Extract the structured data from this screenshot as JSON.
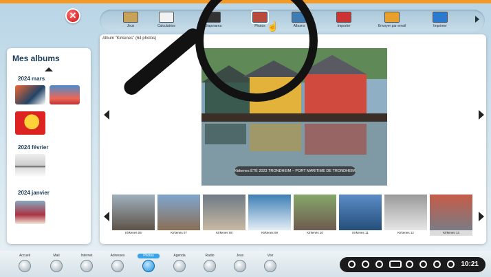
{
  "toolbar": {
    "items": [
      {
        "label": "Jeux",
        "icon": "game-icon",
        "color": "#c9a25a"
      },
      {
        "label": "Calculatrice",
        "icon": "calculator-icon",
        "color": "#f2f2f2"
      },
      {
        "label": "Diaporama",
        "icon": "slideshow-icon",
        "color": "#333333"
      },
      {
        "label": "Photos",
        "icon": "photos-icon",
        "color": "#b94a3c"
      },
      {
        "label": "Albums",
        "icon": "albums-icon",
        "color": "#3d7db3"
      },
      {
        "label": "Importer",
        "icon": "import-icon",
        "color": "#c33"
      },
      {
        "label": "Envoyer par email",
        "icon": "email-icon",
        "color": "#e8a02a"
      },
      {
        "label": "Imprimer",
        "icon": "printer-icon",
        "color": "#2a7bd0"
      }
    ]
  },
  "sidebar": {
    "title": "Mes albums",
    "months": [
      "2024 mars",
      "2024 février",
      "2024 janvier"
    ]
  },
  "main": {
    "album_caption": "Album \"Kirkenes\" (64 photos)",
    "photo_caption": "Kirkenes ÉTÉ 2023 TRONDHEIM – PORT MARITIME DE TRONDHEIM"
  },
  "thumbnails": [
    {
      "label": "Kirkenes 06",
      "color_top": "#9fb0bd",
      "color_bottom": "#5d5348"
    },
    {
      "label": "Kirkenes 07",
      "color_top": "#7fa6cf",
      "color_bottom": "#8a6f55"
    },
    {
      "label": "Kirkenes 08",
      "color_top": "#6f7b85",
      "color_bottom": "#c8b9a4"
    },
    {
      "label": "Kirkenes 09",
      "color_top": "#3e7fb5",
      "color_bottom": "#e3eef5"
    },
    {
      "label": "Kirkenes 10",
      "color_top": "#86a76a",
      "color_bottom": "#6d5b4f"
    },
    {
      "label": "Kirkenes 11",
      "color_top": "#5c8cc8",
      "color_bottom": "#234f79"
    },
    {
      "label": "Kirkenes 12",
      "color_top": "#9a9a9a",
      "color_bottom": "#e6e6e6"
    },
    {
      "label": "Kirkenes 13",
      "color_top": "#c75b47",
      "color_bottom": "#7a7c84"
    }
  ],
  "dock": {
    "items": [
      "Accueil",
      "Mail",
      "Internet",
      "Adresses",
      "Photos",
      "Agenda",
      "Radio",
      "Jeux",
      "Voir"
    ],
    "active": "Photos"
  },
  "system": {
    "time": "10:21"
  },
  "colors": {
    "accent": "#f19a2a",
    "close": "#d11b1b"
  }
}
